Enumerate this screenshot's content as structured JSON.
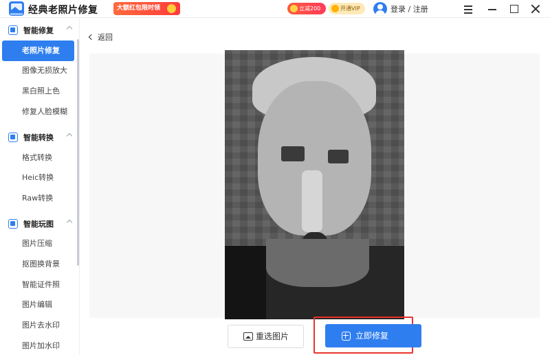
{
  "app": {
    "title": "经典老照片修复"
  },
  "header": {
    "promo_label": "大额红包限时领",
    "coin_badge": "立减200元",
    "vip_label": "开通VIP",
    "login_label": "登录 / 注册"
  },
  "sidebar": {
    "groups": [
      {
        "label": "智能修复",
        "items": [
          {
            "label": "老照片修复",
            "active": true
          },
          {
            "label": "图像无损放大"
          },
          {
            "label": "黑白照上色"
          },
          {
            "label": "修复人脸模糊"
          }
        ]
      },
      {
        "label": "智能转换",
        "items": [
          {
            "label": "格式转换"
          },
          {
            "label": "Heic转换"
          },
          {
            "label": "Raw转换"
          }
        ]
      },
      {
        "label": "智能玩图",
        "items": [
          {
            "label": "图片压缩"
          },
          {
            "label": "抠图换背景"
          },
          {
            "label": "智能证件照"
          },
          {
            "label": "图片编辑"
          },
          {
            "label": "图片去水印"
          },
          {
            "label": "图片加水印"
          }
        ]
      }
    ]
  },
  "main": {
    "back_label": "返回",
    "reselect_label": "重选图片",
    "repair_label": "立即修复",
    "highlight_color": "#e8332b",
    "accent_color": "#2f7ef0"
  }
}
